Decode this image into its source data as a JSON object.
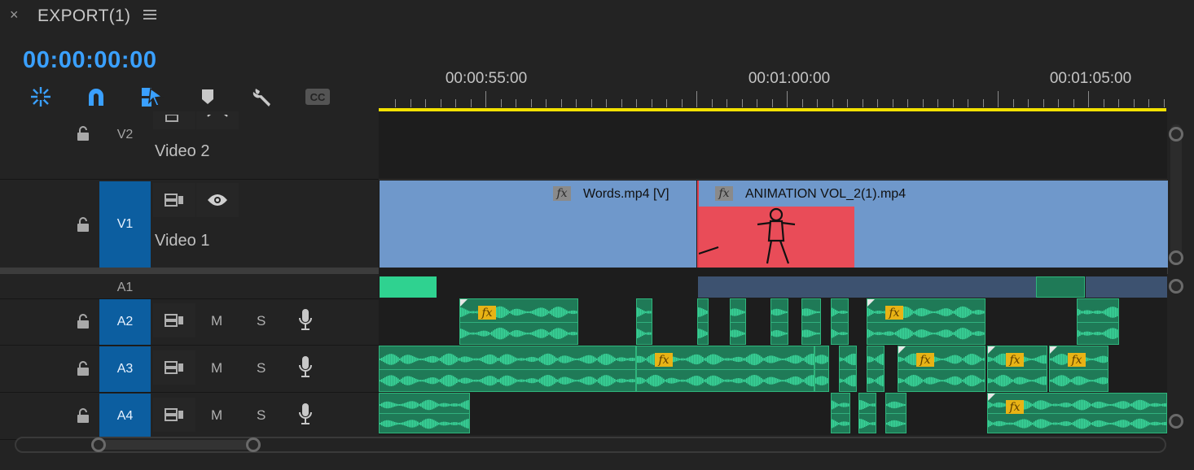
{
  "header": {
    "close_glyph": "×",
    "sequence_title": "EXPORT(1)",
    "menu_icon": "hamburger-menu-icon",
    "timecode": "00:00:00:00"
  },
  "toolbar": {
    "tools": [
      "nest-sequence-icon",
      "snap-magnet-icon",
      "linked-selection-icon",
      "add-marker-icon",
      "settings-wrench-icon",
      "captions-icon"
    ],
    "captions_label": "CC"
  },
  "ruler": {
    "labels": [
      "00:00:55:00",
      "00:01:00:00",
      "00:01:05:00"
    ]
  },
  "tracks": {
    "v2": {
      "name": "V2",
      "label": "Video 2"
    },
    "v1": {
      "name": "V1",
      "label": "Video 1"
    },
    "a1": {
      "name": "A1"
    },
    "a2": {
      "name": "A2",
      "m": "M",
      "s": "S"
    },
    "a3": {
      "name": "A3",
      "m": "M",
      "s": "S"
    },
    "a4": {
      "name": "A4",
      "m": "M",
      "s": "S"
    }
  },
  "clips": {
    "fx_label": "fx",
    "words": "Words.mp4 [V]",
    "animation": "ANIMATION VOL_2(1).mp4"
  },
  "colors": {
    "accent": "#3aa0ff",
    "playhead_bar": "#f2e100",
    "video_clip": "#6f98cb",
    "audio_clip": "#1f7a57",
    "track_selected": "#0c5ea0"
  }
}
